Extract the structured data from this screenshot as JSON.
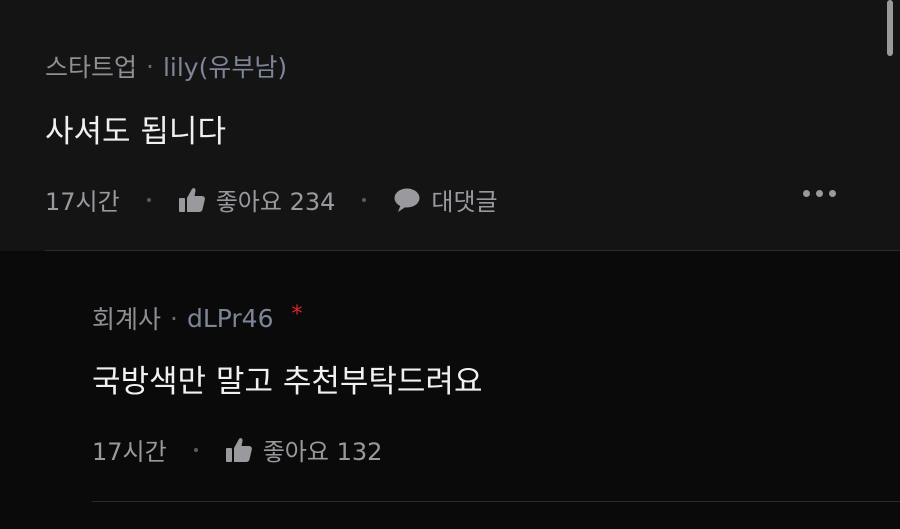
{
  "comment": {
    "category": "스타트업",
    "separator": "·",
    "nickname": "lily(유부남)",
    "text": "사셔도 됩니다",
    "time": "17시간",
    "like_label": "좋아요 234",
    "reply_label": "대댓글",
    "more_icon": "more-horizontal-icon"
  },
  "reply": {
    "category": "회계사",
    "separator": "·",
    "nickname": "dLPr46",
    "author_mark": "*",
    "text": "국방색만 말고 추천부탁드려요",
    "time": "17시간",
    "like_label": "좋아요 132"
  },
  "colors": {
    "background": "#0a0a0b",
    "comment_background": "#141415",
    "nickname": "#7d8597",
    "author_mark": "#e0242b"
  }
}
